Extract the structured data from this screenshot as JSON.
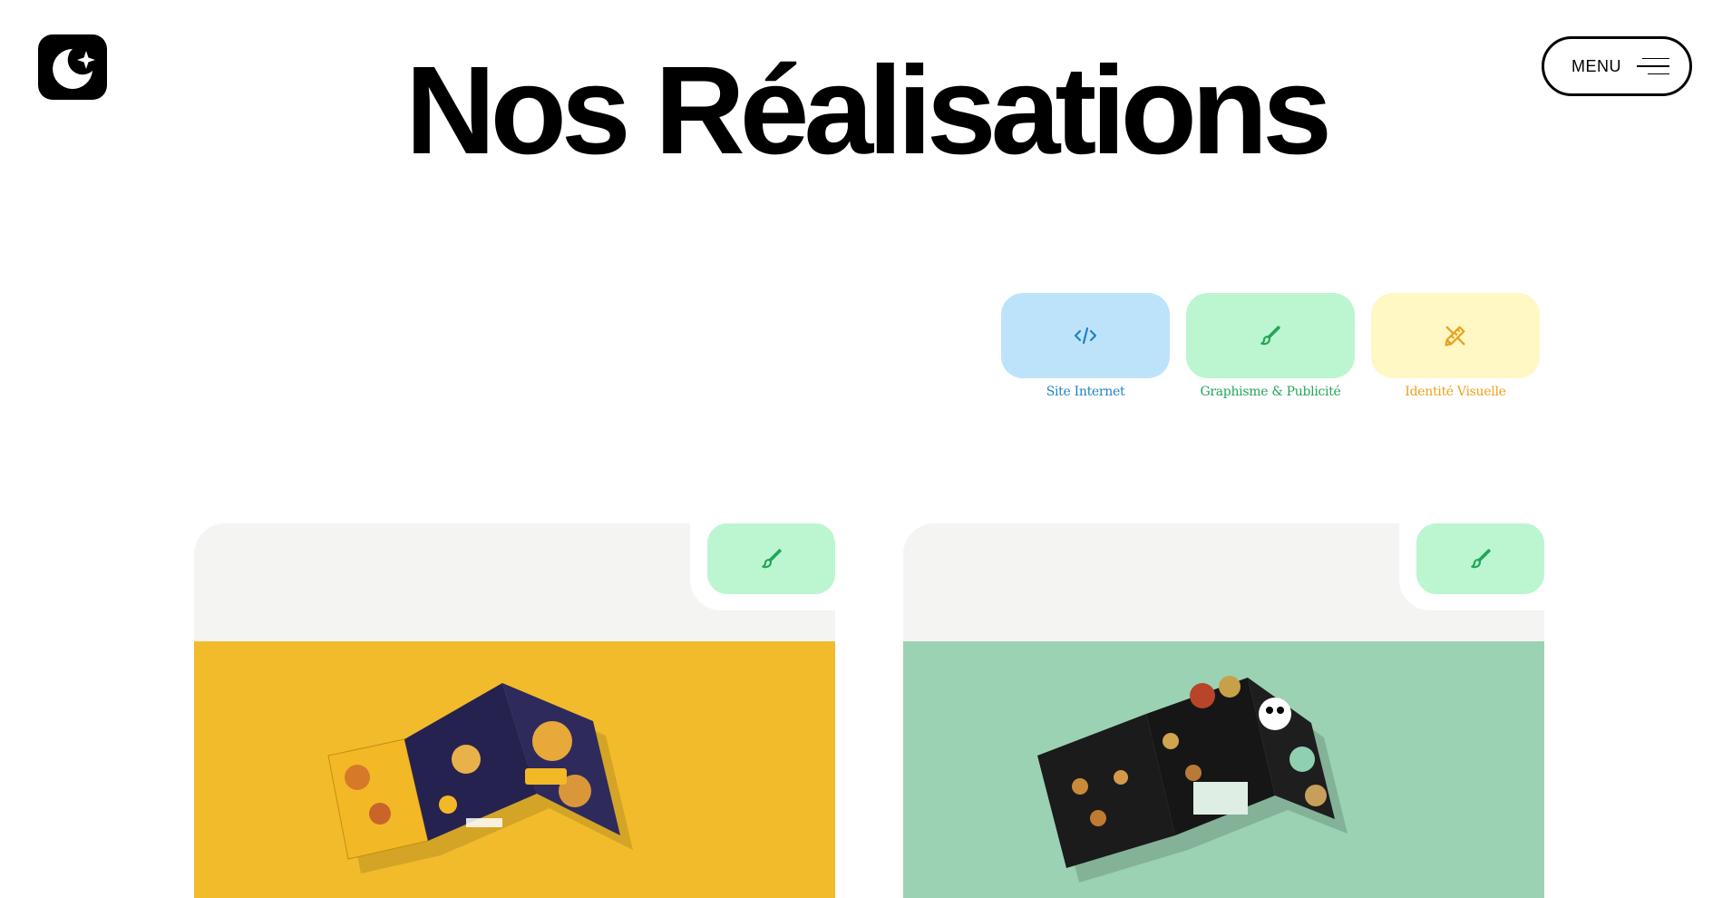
{
  "header": {
    "logo_icon": "moon-star-logo-icon",
    "title": "Nos Réalisations",
    "menu_label": "MENU",
    "menu_icon": "hamburger-lines-icon"
  },
  "filters": [
    {
      "label": "Site Internet",
      "icon": "code-icon",
      "bg": "#bde3fb",
      "color": "#1f82c3"
    },
    {
      "label": "Graphisme & Publicité",
      "icon": "brush-icon",
      "bg": "#bbf6d0",
      "color": "#22a659"
    },
    {
      "label": "Identité Visuelle",
      "icon": "pencil-ruler-icon",
      "bg": "#fff8c5",
      "color": "#e8a21c"
    }
  ],
  "projects": [
    {
      "category_icon": "brush-icon",
      "badge_bg": "#bbf6d0",
      "image_bg": "#f2bb2c",
      "image": "pizza-menu-brochure-mockup"
    },
    {
      "category_icon": "brush-icon",
      "badge_bg": "#bbf6d0",
      "image_bg": "#9bd2b3",
      "image": "asian-kitchen-menu-brochure-mockup"
    }
  ]
}
